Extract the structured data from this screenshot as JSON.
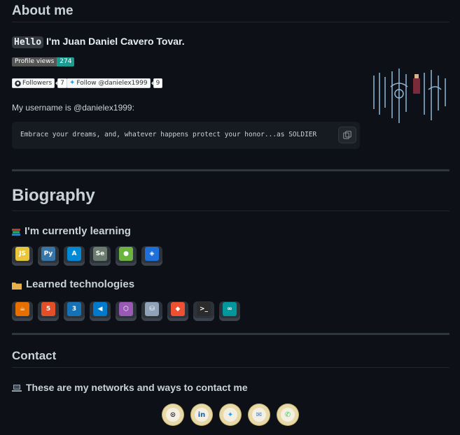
{
  "about": {
    "heading": "About me",
    "hello": "Hello",
    "intro": " I'm Juan Daniel Cavero Tovar.",
    "profile_views_label": "Profile views",
    "profile_views_count": "274",
    "followers_label": "Followers",
    "followers_count": "7",
    "twitter_label": "Follow @danielex1999",
    "twitter_count": "9",
    "username_text": "My username is @danielex1999:",
    "quote": "Embrace your dreams, and, whatever happens protect your honor...as SOLDIER"
  },
  "biography": {
    "heading": "Biography",
    "learning_heading": "I'm currently learning",
    "learning_icon": "books-icon",
    "learning_tech": [
      {
        "name": "js-icon",
        "glyph": "JS",
        "color": "#e8c53a"
      },
      {
        "name": "python-icon",
        "glyph": "Py",
        "color": "#3776ab"
      },
      {
        "name": "azure-icon",
        "glyph": "A",
        "color": "#0089d6"
      },
      {
        "name": "selenium-icon",
        "glyph": "Se",
        "color": "#6b7b6e"
      },
      {
        "name": "spring-icon",
        "glyph": "●",
        "color": "#6db33f"
      },
      {
        "name": "codepen-icon",
        "glyph": "◈",
        "color": "#1e6fd9"
      }
    ],
    "learned_heading": "Learned technologies",
    "learned_icon": "folder-icon",
    "learned_tech": [
      {
        "name": "java-icon",
        "glyph": "☕",
        "color": "#e76f00"
      },
      {
        "name": "html5-icon",
        "glyph": "5",
        "color": "#e34f26"
      },
      {
        "name": "css3-icon",
        "glyph": "3",
        "color": "#1572b6"
      },
      {
        "name": "vscode-icon",
        "glyph": "◀",
        "color": "#007acc"
      },
      {
        "name": "sourcetree-icon",
        "glyph": "⬡",
        "color": "#9b59b6"
      },
      {
        "name": "database-icon",
        "glyph": "⛁",
        "color": "#8fa2b8"
      },
      {
        "name": "git-icon",
        "glyph": "◆",
        "color": "#f05032"
      },
      {
        "name": "terminal-icon",
        "glyph": ">_",
        "color": "#2b2b2b"
      },
      {
        "name": "arduino-icon",
        "glyph": "∞",
        "color": "#00979d"
      }
    ]
  },
  "contact": {
    "heading": "Contact",
    "networks_text": "These are my networks and ways to contact me",
    "networks_icon": "laptop-icon",
    "links": [
      {
        "name": "github-link",
        "glyph": "⊙",
        "bg": "#e7d9a8",
        "fg": "#24292e"
      },
      {
        "name": "linkedin-link",
        "glyph": "in",
        "bg": "#e7d9a8",
        "fg": "#0a66c2"
      },
      {
        "name": "twitter-link",
        "glyph": "✦",
        "bg": "#e7d9a8",
        "fg": "#1da1f2"
      },
      {
        "name": "email-link",
        "glyph": "✉",
        "bg": "#e7d9a8",
        "fg": "#4a7fc1"
      },
      {
        "name": "whatsapp-link",
        "glyph": "✆",
        "bg": "#e7d9a8",
        "fg": "#25d366"
      }
    ]
  }
}
